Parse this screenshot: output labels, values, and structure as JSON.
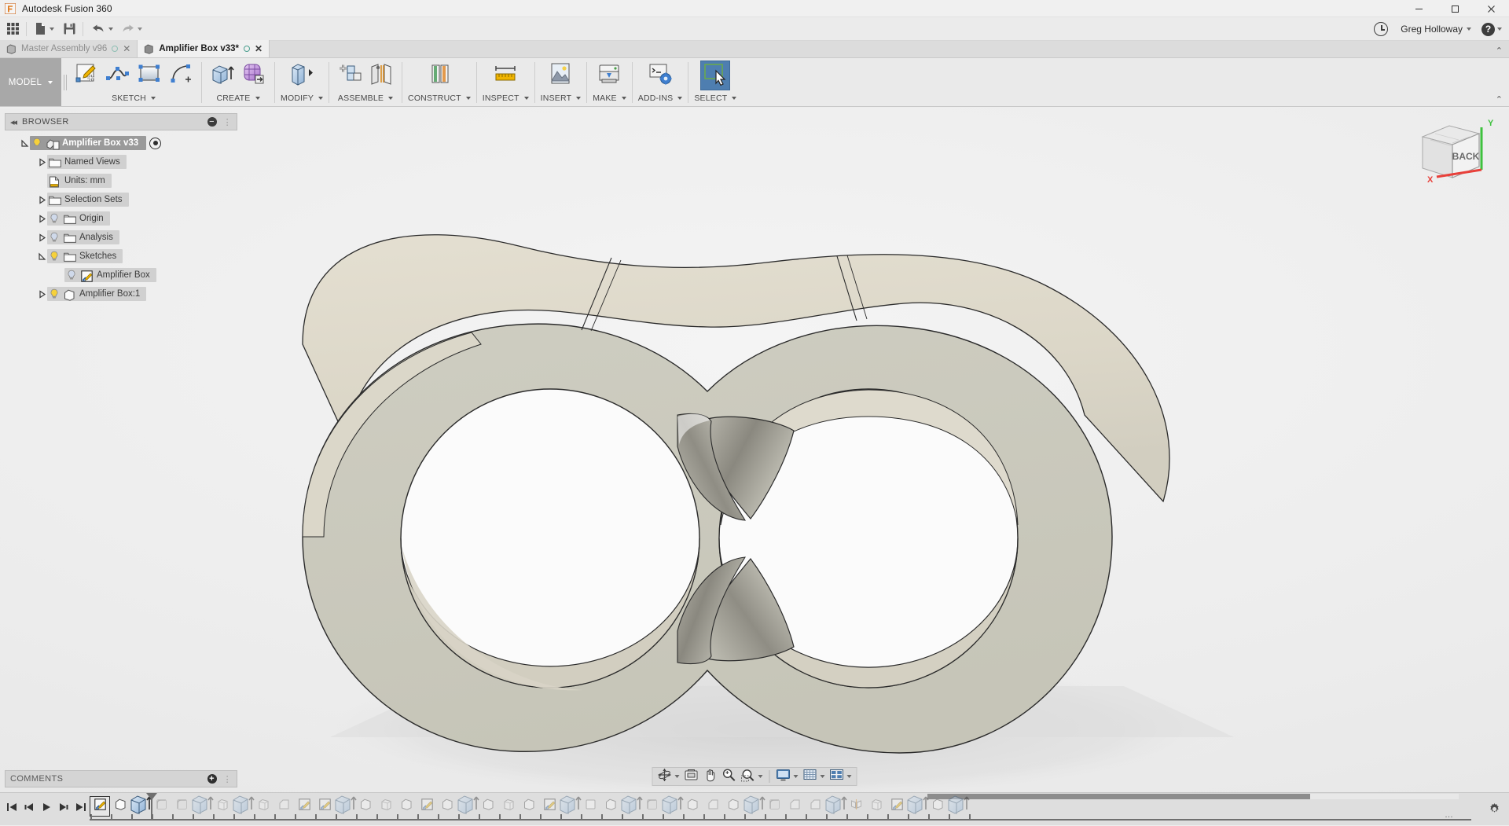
{
  "window": {
    "app_title": "Autodesk Fusion 360",
    "minimize_label": "─",
    "maximize_label": "❐",
    "close_label": "✕"
  },
  "quick_access": {
    "grid_icon": "app-grid-icon",
    "new_icon": "new-document-icon",
    "save_icon": "save-icon",
    "undo_icon": "undo-icon",
    "redo_icon": "redo-icon",
    "recent_icon": "clock-history-icon",
    "user_name": "Greg Holloway",
    "help_icon": "help-icon",
    "help_label": "?"
  },
  "document_tabs": [
    {
      "label": "Master Assembly v96",
      "active": false,
      "close_label": "✕"
    },
    {
      "label": "Amplifier Box v33*",
      "active": true,
      "close_label": "✕"
    }
  ],
  "ribbon": {
    "workspace_label": "MODEL",
    "collapse_label": "⌃",
    "groups": [
      {
        "label": "SKETCH",
        "name": "sketch",
        "icons": [
          "create-sketch-icon",
          "spline-icon",
          "rectangle-icon",
          "arc-icon"
        ]
      },
      {
        "label": "CREATE",
        "name": "create",
        "icons": [
          "extrude-icon",
          "form-icon"
        ]
      },
      {
        "label": "MODIFY",
        "name": "modify",
        "icons": [
          "press-pull-icon"
        ]
      },
      {
        "label": "ASSEMBLE",
        "name": "assemble",
        "icons": [
          "new-component-icon",
          "joint-icon"
        ]
      },
      {
        "label": "CONSTRUCT",
        "name": "construct",
        "icons": [
          "offset-plane-icon"
        ]
      },
      {
        "label": "INSPECT",
        "name": "inspect",
        "icons": [
          "measure-icon"
        ]
      },
      {
        "label": "INSERT",
        "name": "insert",
        "icons": [
          "insert-image-icon"
        ]
      },
      {
        "label": "MAKE",
        "name": "make",
        "icons": [
          "3d-print-icon"
        ]
      },
      {
        "label": "ADD-INS",
        "name": "addins",
        "icons": [
          "scripts-addins-icon"
        ]
      },
      {
        "label": "SELECT",
        "name": "select",
        "icons": [
          "select-window-icon"
        ]
      }
    ]
  },
  "browser": {
    "title": "BROWSER",
    "collapse_icon": "collapse-left-icon",
    "minimize_icon": "minimize-panel-icon",
    "grip_icon": "resize-grip-icon",
    "tree": [
      {
        "label": "Amplifier Box v33",
        "indent": 0,
        "expander": "expanded",
        "bulb": "on",
        "icon": "component-icon",
        "style": "dark",
        "eye": true
      },
      {
        "label": "Named Views",
        "indent": 1,
        "expander": "collapsed",
        "bulb": "none",
        "icon": "folder-icon",
        "style": "shade",
        "eye": false
      },
      {
        "label": "Units: mm",
        "indent": 1,
        "expander": "none",
        "bulb": "none",
        "icon": "units-icon",
        "style": "shade",
        "eye": false
      },
      {
        "label": "Selection Sets",
        "indent": 1,
        "expander": "collapsed",
        "bulb": "none",
        "icon": "folder-icon",
        "style": "shade",
        "eye": false
      },
      {
        "label": "Origin",
        "indent": 1,
        "expander": "collapsed",
        "bulb": "off",
        "icon": "folder-icon",
        "style": "shade",
        "eye": false
      },
      {
        "label": "Analysis",
        "indent": 1,
        "expander": "collapsed",
        "bulb": "off",
        "icon": "folder-icon",
        "style": "shade",
        "eye": false
      },
      {
        "label": "Sketches",
        "indent": 1,
        "expander": "expanded",
        "bulb": "on",
        "icon": "folder-icon",
        "style": "shade",
        "eye": false
      },
      {
        "label": "Amplifier Box",
        "indent": 2,
        "expander": "none",
        "bulb": "off",
        "icon": "sketch-icon",
        "style": "shade",
        "eye": false
      },
      {
        "label": "Amplifier Box:1",
        "indent": 1,
        "expander": "collapsed",
        "bulb": "on",
        "icon": "body-icon",
        "style": "shade",
        "eye": false
      }
    ]
  },
  "comments": {
    "title": "COMMENTS",
    "add_icon": "add-comment-icon",
    "grip_icon": "resize-grip-icon"
  },
  "navbar": {
    "items": [
      {
        "name": "orbit-icon",
        "caret": true
      },
      {
        "name": "look-at-icon",
        "caret": false
      },
      {
        "name": "pan-icon",
        "caret": false
      },
      {
        "name": "zoom-icon",
        "caret": false
      },
      {
        "name": "zoom-window-icon",
        "caret": true
      },
      {
        "name": "display-settings-icon",
        "caret": true
      },
      {
        "name": "grid-snaps-icon",
        "caret": true
      },
      {
        "name": "viewports-icon",
        "caret": true
      }
    ]
  },
  "viewcube": {
    "face_label": "BACK",
    "axis_x_label": "X",
    "axis_y_label": "Y",
    "axis_x_color": "#e8403a",
    "axis_y_color": "#3ec13e"
  },
  "timeline": {
    "playback": [
      {
        "name": "jump-to-beginning-icon"
      },
      {
        "name": "step-back-icon"
      },
      {
        "name": "play-icon"
      },
      {
        "name": "step-forward-icon"
      },
      {
        "name": "jump-to-end-icon"
      }
    ],
    "settings_icon": "timeline-settings-icon",
    "overflow_label": "…",
    "features": [
      {
        "icon": "sketch-icon",
        "state": "selected"
      },
      {
        "icon": "body-icon",
        "state": "normal"
      },
      {
        "icon": "extrude-icon",
        "state": "normal"
      },
      {
        "icon": "fillet-icon",
        "state": "ghost"
      },
      {
        "icon": "fillet-icon",
        "state": "ghost"
      },
      {
        "icon": "extrude-icon",
        "state": "ghost"
      },
      {
        "icon": "shell-icon",
        "state": "ghost"
      },
      {
        "icon": "extrude-icon",
        "state": "ghost"
      },
      {
        "icon": "shell-icon",
        "state": "ghost"
      },
      {
        "icon": "chamfer-icon",
        "state": "ghost"
      },
      {
        "icon": "sketch-icon",
        "state": "ghost"
      },
      {
        "icon": "sketch-icon",
        "state": "ghost"
      },
      {
        "icon": "extrude-icon",
        "state": "ghost"
      },
      {
        "icon": "body-icon",
        "state": "ghost"
      },
      {
        "icon": "shell-icon",
        "state": "ghost"
      },
      {
        "icon": "body-icon",
        "state": "ghost"
      },
      {
        "icon": "sketch-icon",
        "state": "ghost"
      },
      {
        "icon": "body-icon",
        "state": "ghost"
      },
      {
        "icon": "extrude-icon",
        "state": "ghost"
      },
      {
        "icon": "body-icon",
        "state": "ghost"
      },
      {
        "icon": "shell-icon",
        "state": "ghost"
      },
      {
        "icon": "body-icon",
        "state": "ghost"
      },
      {
        "icon": "sketch-icon",
        "state": "ghost"
      },
      {
        "icon": "extrude-icon",
        "state": "ghost"
      },
      {
        "icon": "plain-body-icon",
        "state": "ghost"
      },
      {
        "icon": "body-icon",
        "state": "ghost"
      },
      {
        "icon": "extrude-icon",
        "state": "ghost"
      },
      {
        "icon": "fillet-icon",
        "state": "ghost"
      },
      {
        "icon": "extrude-icon",
        "state": "ghost"
      },
      {
        "icon": "body-icon",
        "state": "ghost"
      },
      {
        "icon": "chamfer-icon",
        "state": "ghost"
      },
      {
        "icon": "body-icon",
        "state": "ghost"
      },
      {
        "icon": "extrude-icon",
        "state": "ghost"
      },
      {
        "icon": "fillet-icon",
        "state": "ghost"
      },
      {
        "icon": "chamfer-icon",
        "state": "ghost"
      },
      {
        "icon": "chamfer-icon",
        "state": "ghost"
      },
      {
        "icon": "extrude-icon",
        "state": "ghost"
      },
      {
        "icon": "mirror-icon",
        "state": "ghost"
      },
      {
        "icon": "shell-icon",
        "state": "ghost"
      },
      {
        "icon": "sketch-icon",
        "state": "ghost"
      },
      {
        "icon": "extrude-icon",
        "state": "ghost"
      },
      {
        "icon": "body-icon",
        "state": "ghost"
      },
      {
        "icon": "extrude-icon",
        "state": "ghost"
      }
    ]
  },
  "model": {
    "body_color": "#c9c8bc",
    "top_face_color": "#ddd8ca",
    "inner_dark_color": "#8e8c83",
    "edge_color": "#2b2b2b",
    "shadow_color": "#d8d8d8",
    "background_color": "#efefef"
  }
}
